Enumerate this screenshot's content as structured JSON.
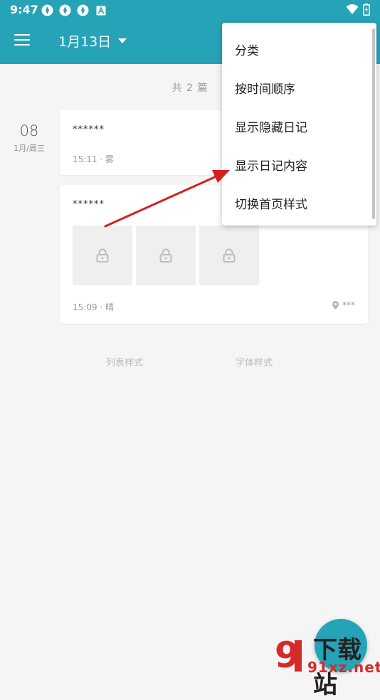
{
  "status_bar": {
    "time": "9:47",
    "notification_icons": [
      "app-notification-icon",
      "app-notification-icon",
      "app-notification-icon",
      "a-icon"
    ],
    "right_icons": [
      "wifi-icon",
      "battery-icon"
    ]
  },
  "app_bar": {
    "title": "1月13日",
    "menu_icon": "menu-icon",
    "dropdown_icon": "caret-down-icon"
  },
  "summary": {
    "count_text": "共 2 篇"
  },
  "date_group": {
    "day": "08",
    "sub": "1月/周三"
  },
  "entries": [
    {
      "title": "******",
      "meta": "15:11 · 雾"
    },
    {
      "title": "******",
      "meta": "15:09 · 晴",
      "location": "***",
      "thumbs": [
        "lock-icon",
        "lock-icon",
        "lock-icon"
      ]
    }
  ],
  "bottom_links": {
    "list_style": "列表样式",
    "font_style": "字体样式"
  },
  "overflow_menu": {
    "items": [
      "分类",
      "按时间顺序",
      "显示隐藏日记",
      "显示日记内容",
      "切换首页样式"
    ]
  },
  "watermark": {
    "brand_cn": "下载站",
    "brand_url": "91xz.net",
    "logo_text": "91"
  },
  "colors": {
    "primary": "#27a3b7",
    "annotation_arrow": "#d42020",
    "watermark_red": "#d52a2a"
  }
}
